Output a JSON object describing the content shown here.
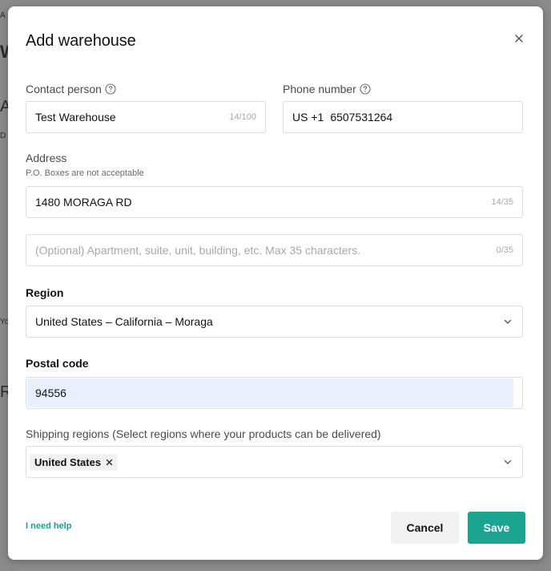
{
  "background": {
    "fragments": [
      "A",
      "Wa",
      "A",
      "D",
      "Yo",
      "R"
    ]
  },
  "modal": {
    "title": "Add warehouse",
    "close_icon": "close-icon"
  },
  "contact_person": {
    "label": "Contact person",
    "value": "Test Warehouse",
    "counter": "14/100"
  },
  "phone_number": {
    "label": "Phone number",
    "country_code": "US +1",
    "value": "6507531264"
  },
  "address": {
    "label": "Address",
    "note": "P.O. Boxes are not acceptable",
    "line1_value": "1480 MORAGA RD",
    "line1_counter": "14/35",
    "line2_placeholder": "(Optional) Apartment, suite, unit, building, etc. Max 35 characters.",
    "line2_counter": "0/35"
  },
  "region": {
    "label": "Region",
    "value": "United States – California – Moraga"
  },
  "postal_code": {
    "label": "Postal code",
    "value": "94556"
  },
  "shipping_regions": {
    "label": "Shipping regions (Select regions where your products can be delivered)",
    "selected": [
      "United States"
    ]
  },
  "footer": {
    "help_link": "I need help",
    "cancel_label": "Cancel",
    "save_label": "Save"
  },
  "colors": {
    "accent": "#1aa592",
    "link": "#1a9f8d",
    "autofill": "#e8f0fe"
  }
}
